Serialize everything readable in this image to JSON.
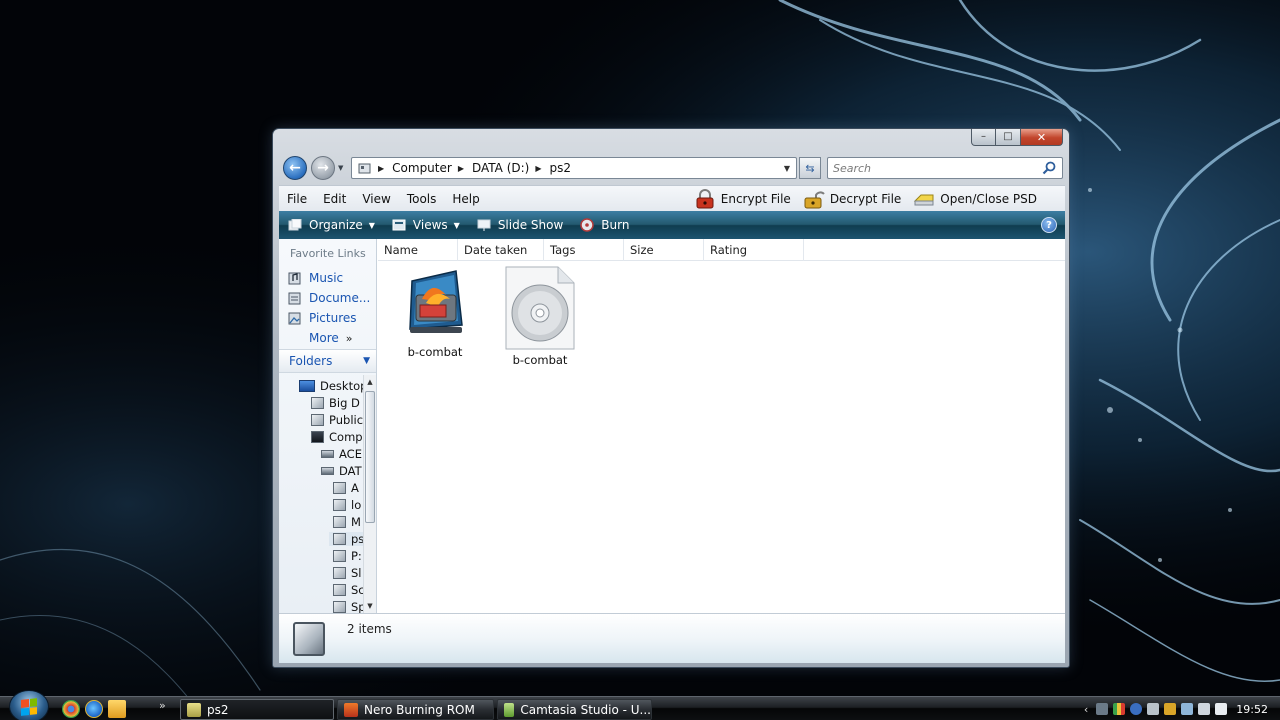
{
  "window": {
    "title_buttons": {
      "minimize": "–",
      "maximize": "□",
      "close": "✕"
    }
  },
  "address": {
    "segments": [
      "Computer",
      "DATA (D:)",
      "ps2"
    ],
    "search_placeholder": "Search"
  },
  "menu": {
    "items": [
      "File",
      "Edit",
      "View",
      "Tools",
      "Help"
    ],
    "extensions": [
      "Encrypt File",
      "Decrypt File",
      "Open/Close PSD"
    ]
  },
  "commands": {
    "organize": "Organize",
    "views": "Views",
    "slideshow": "Slide Show",
    "burn": "Burn",
    "help": "?"
  },
  "nav_pane": {
    "favorites_title": "Favorite Links",
    "favorites": [
      "Music",
      "Docume...",
      "Pictures"
    ],
    "more": "More",
    "more_glyph": "»",
    "folders_label": "Folders",
    "tree": [
      "Desktop",
      "Big D",
      "Public",
      "Comp",
      "ACE",
      "DAT",
      "A",
      "lo",
      "M",
      "ps",
      "P:",
      "Sl",
      "Sc",
      "Sp"
    ]
  },
  "columns": [
    "Name",
    "Date taken",
    "Tags",
    "Size",
    "Rating"
  ],
  "files": [
    {
      "name": "b-combat",
      "icon": "nero-image-icon"
    },
    {
      "name": "b-combat",
      "icon": "disc-image-icon"
    }
  ],
  "details": {
    "count": "2 items"
  },
  "taskbar": {
    "buttons": [
      "ps2",
      "Nero Burning ROM",
      "Camtasia Studio - U..."
    ],
    "clock": "19:52",
    "quick_more": "»",
    "tray_arrow": "‹"
  },
  "colors": {
    "link": "#1a55b1",
    "command_bar": "#23596f",
    "close_button": "#c2452c"
  }
}
